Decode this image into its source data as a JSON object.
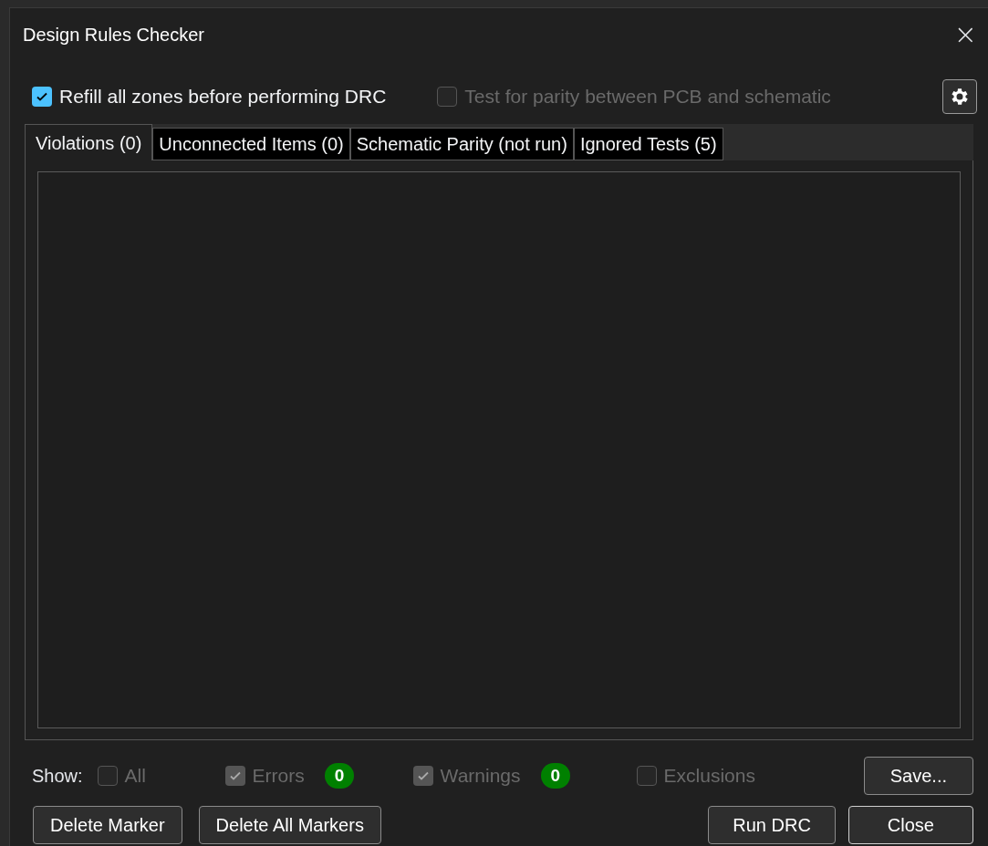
{
  "window": {
    "title": "Design Rules Checker",
    "close": "×"
  },
  "options": [
    {
      "label": "Refill all zones before performing DRC",
      "checked": true,
      "disabled": false
    },
    {
      "label": "Test for parity between PCB and schematic",
      "checked": false,
      "disabled": true
    }
  ],
  "tabs": [
    {
      "label": "Violations (0)",
      "selected": true
    },
    {
      "label": "Unconnected Items (0)",
      "selected": false
    },
    {
      "label": "Schematic Parity (not run)",
      "selected": false
    },
    {
      "label": "Ignored Tests (5)",
      "selected": false
    }
  ],
  "show": {
    "label": "Show:",
    "filters": [
      {
        "label": "All",
        "checked": false,
        "disabled": true
      },
      {
        "label": "Errors",
        "checked": true,
        "disabled": true,
        "count": "0"
      },
      {
        "label": "Warnings",
        "checked": true,
        "disabled": true,
        "count": "0"
      },
      {
        "label": "Exclusions",
        "checked": false,
        "disabled": true
      }
    ]
  },
  "save_button": "Save...",
  "left_buttons": [
    "Delete Marker",
    "Delete All Markers"
  ],
  "right_buttons": [
    "Run DRC",
    "Close"
  ]
}
